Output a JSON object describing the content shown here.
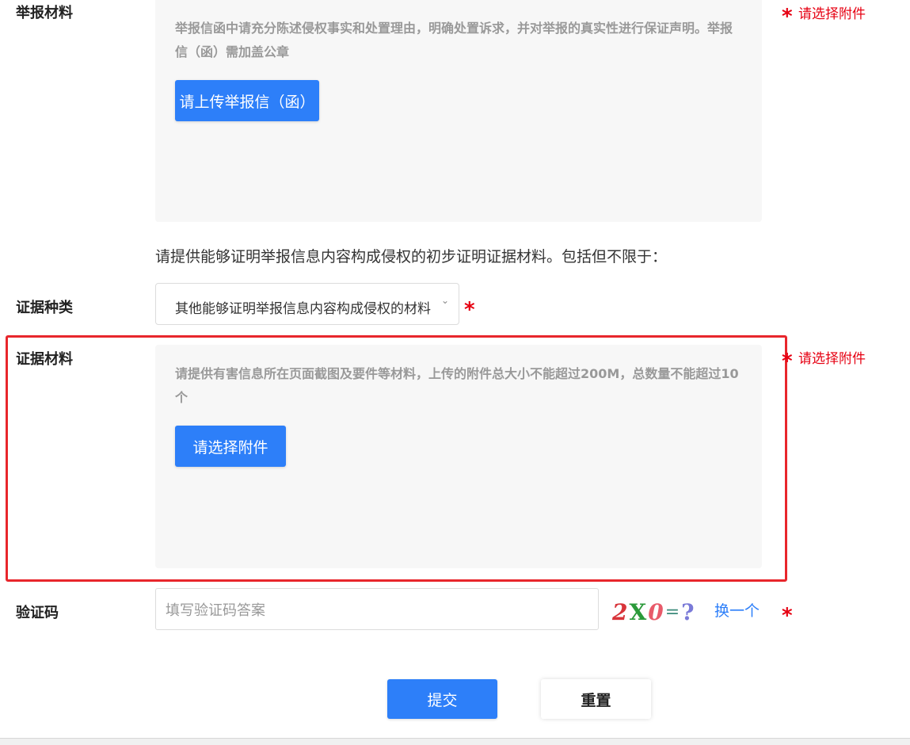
{
  "report_materials": {
    "label": "举报材料",
    "hint": "举报信函中请充分陈述侵权事实和处置理由，明确处置诉求，并对举报的真实性进行保证声明。举报信（函）需加盖公章",
    "upload_label": "请上传举报信（函）",
    "error": "请选择附件",
    "required_mark": "*"
  },
  "evidence_intro": "请提供能够证明举报信息内容构成侵权的初步证明证据材料。包括但不限于：",
  "evidence_type": {
    "label": "证据种类",
    "selected": "其他能够证明举报信息内容构成侵权的材料",
    "required_mark": "*"
  },
  "evidence_materials": {
    "label": "证据材料",
    "hint": "请提供有害信息所在页面截图及要件等材料，上传的附件总大小不能超过200M，总数量不能超过10个",
    "upload_label": "请选择附件",
    "error": "请选择附件",
    "required_mark": "*"
  },
  "captcha": {
    "label": "验证码",
    "placeholder": "填写验证码答案",
    "image_chars": [
      "2",
      "X",
      "0",
      "=",
      "?"
    ],
    "refresh_label": "换一个",
    "required_mark": "*"
  },
  "actions": {
    "submit_label": "提交",
    "reset_label": "重置"
  },
  "colors": {
    "primary": "#2d7ff9",
    "error": "#e60012",
    "highlight_border": "#e8262c",
    "panel_bg": "#f7f7f7"
  }
}
